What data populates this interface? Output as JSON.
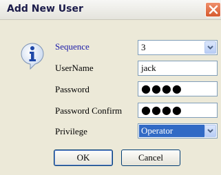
{
  "window": {
    "title": "Add New User"
  },
  "icons": {
    "info": "info-icon",
    "close": "close-icon",
    "dropdown": "chevron-down-icon"
  },
  "form": {
    "sequence": {
      "label": "Sequence",
      "value": "3"
    },
    "username": {
      "label": "UserName",
      "value": "jack"
    },
    "password": {
      "label": "Password",
      "value": "●●●●"
    },
    "password_confirm": {
      "label": "Password Confirm",
      "value": "●●●●"
    },
    "privilege": {
      "label": "Privilege",
      "value": "Operator"
    }
  },
  "buttons": {
    "ok_label": "OK",
    "cancel_label": "Cancel"
  },
  "colors": {
    "accent": "#316ac5",
    "close": "#d65a2e",
    "dialog_bg": "#ece9d8"
  }
}
